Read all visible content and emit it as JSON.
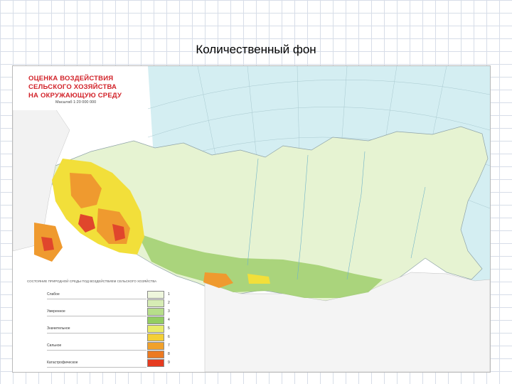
{
  "slide": {
    "title": "Количественный фон"
  },
  "map": {
    "title_lines": [
      "ОЦЕНКА ВОЗДЕЙСТВИЯ",
      "СЕЛЬСКОГО ХОЗЯЙСТВА",
      "НА ОКРУЖАЮЩУЮ СРЕДУ"
    ],
    "scale": "Масштаб 1:20 000 000",
    "colors": {
      "sea": "#d4eef2",
      "land_base": "#e6f3d2",
      "low_impact": "#cfe6a8",
      "moderate_impact": "#9fce6d",
      "high_yellow": "#f2df3a",
      "high_orange": "#ef9a2f",
      "very_high_red": "#e0462c",
      "outline": "#8fa3a8"
    }
  },
  "legend": {
    "title": "СОСТОЯНИЕ ПРИРОДНОЙ СРЕДЫ ПОД ВОЗДЕЙСТВИЕМ СЕЛЬСКОГО ХОЗЯЙСТВА",
    "items": [
      {
        "label": "Слабое",
        "num": "1",
        "color": "#eef6dc"
      },
      {
        "label": "",
        "num": "2",
        "color": "#d6ecb4"
      },
      {
        "label": "Умеренное",
        "num": "3",
        "color": "#b7de8a"
      },
      {
        "label": "",
        "num": "4",
        "color": "#93cd62"
      },
      {
        "label": "Значительное",
        "num": "5",
        "color": "#e8ec6a"
      },
      {
        "label": "",
        "num": "6",
        "color": "#f4cf36"
      },
      {
        "label": "Сильное",
        "num": "7",
        "color": "#f1a12b"
      },
      {
        "label": "",
        "num": "8",
        "color": "#ec7a22"
      },
      {
        "label": "Катастрофическое",
        "num": "9",
        "color": "#e63b20"
      }
    ]
  }
}
